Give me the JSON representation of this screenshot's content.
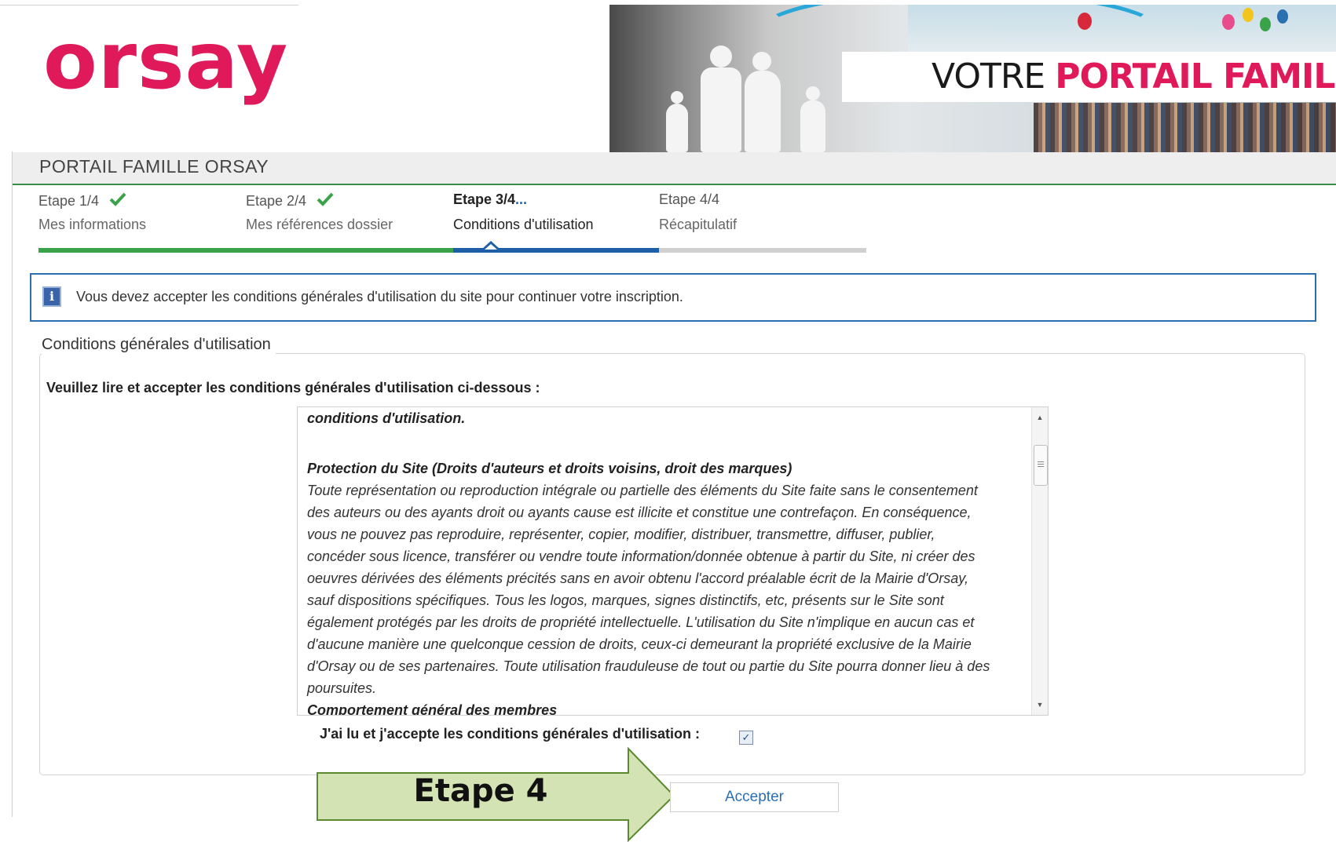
{
  "header": {
    "logo_text": "orsay",
    "banner_title_part1": "VOTRE ",
    "banner_title_part2": "PORTAIL FAMILLE"
  },
  "page_title": "PORTAIL FAMILLE ORSAY",
  "steps": [
    {
      "number": "Etape 1/4",
      "label": "Mes informations",
      "status": "done"
    },
    {
      "number": "Etape 2/4",
      "label": "Mes références dossier",
      "status": "done"
    },
    {
      "number": "Etape 3/4",
      "suffix": "...",
      "label": "Conditions d'utilisation",
      "status": "current"
    },
    {
      "number": "Etape 4/4",
      "label": "Récapitulatif",
      "status": "pending"
    }
  ],
  "info_message": "Vous devez accepter les conditions générales d'utilisation du site pour continuer votre inscription.",
  "fieldset": {
    "legend": "Conditions générales d'utilisation",
    "instruction": "Veuillez lire et accepter les conditions générales d'utilisation ci-dessous :",
    "terms": {
      "intro_heading": "conditions d'utilisation.",
      "section1_heading": "Protection du Site (Droits d'auteurs et droits voisins, droit des marques)",
      "section1_lines": [
        "Toute représentation ou reproduction intégrale ou partielle des éléments du Site faite sans le consentement",
        "des auteurs ou des ayants droit ou ayants cause est illicite et constitue une contrefaçon. En conséquence,",
        "vous ne pouvez pas reproduire, représenter, copier, modifier, distribuer, transmettre, diffuser, publier,",
        "concéder sous licence, transférer ou vendre toute information/donnée obtenue à partir du Site, ni créer des",
        "oeuvres dérivées des éléments précités sans en avoir obtenu l'accord préalable écrit de la Mairie d'Orsay,",
        "sauf dispositions spécifiques. Tous les logos, marques, signes distinctifs, etc, présents sur le Site sont",
        "également protégés par les droits de propriété intellectuelle. L'utilisation du Site n'implique en aucun cas et",
        "d'aucune manière une quelconque cession de droits, ceux-ci demeurant la propriété exclusive de la Mairie",
        "d'Orsay ou de ses partenaires. Toute utilisation frauduleuse de tout ou partie du Site pourra donner lieu à des",
        "poursuites."
      ],
      "section2_heading": "Comportement général des membres"
    },
    "accept_label": "J'ai lu et j'accepte les conditions générales d'utilisation :",
    "accept_checked": true
  },
  "accept_button": "Accepter",
  "annotation_arrow": "Etape 4",
  "colors": {
    "brand_pink": "#e0195b",
    "done_green": "#3aa34a",
    "current_blue": "#1f5fa8",
    "pending_grey": "#d0d0d0",
    "arrow_fill": "#d3e3b3",
    "arrow_stroke": "#5b8a2f"
  },
  "icons": {
    "step_done": "check-icon",
    "info": "info-icon",
    "checkbox": "checkmark"
  }
}
